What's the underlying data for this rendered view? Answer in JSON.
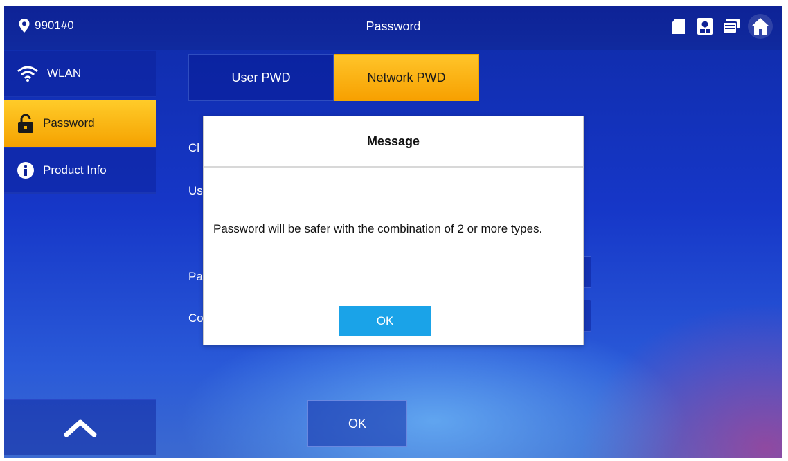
{
  "topbar": {
    "location": "9901#0",
    "title": "Password",
    "icons": [
      "location-pin-icon",
      "sd-card-icon",
      "camera-status-icon",
      "monitor-icon",
      "home-icon"
    ]
  },
  "sidebar": {
    "items": [
      {
        "label": "WLAN",
        "icon": "wifi-icon",
        "active": false
      },
      {
        "label": "Password",
        "icon": "lock-icon",
        "active": true
      },
      {
        "label": "Product Info",
        "icon": "info-icon",
        "active": false
      }
    ],
    "scroll_icon": "chevron-up-icon"
  },
  "tabs": [
    {
      "label": "User PWD",
      "active": false
    },
    {
      "label": "Network PWD",
      "active": true
    }
  ],
  "form": {
    "labels": [
      "Cl",
      "Us",
      "Pa",
      "Co"
    ]
  },
  "footer": {
    "ok_label": "OK"
  },
  "dialog": {
    "title": "Message",
    "message": "Password will be safer with the combination of 2 or more types.",
    "ok_label": "OK"
  },
  "colors": {
    "accent": "#f7a800",
    "dialog_button": "#1aa3e8",
    "topbar": "#0e2296"
  }
}
